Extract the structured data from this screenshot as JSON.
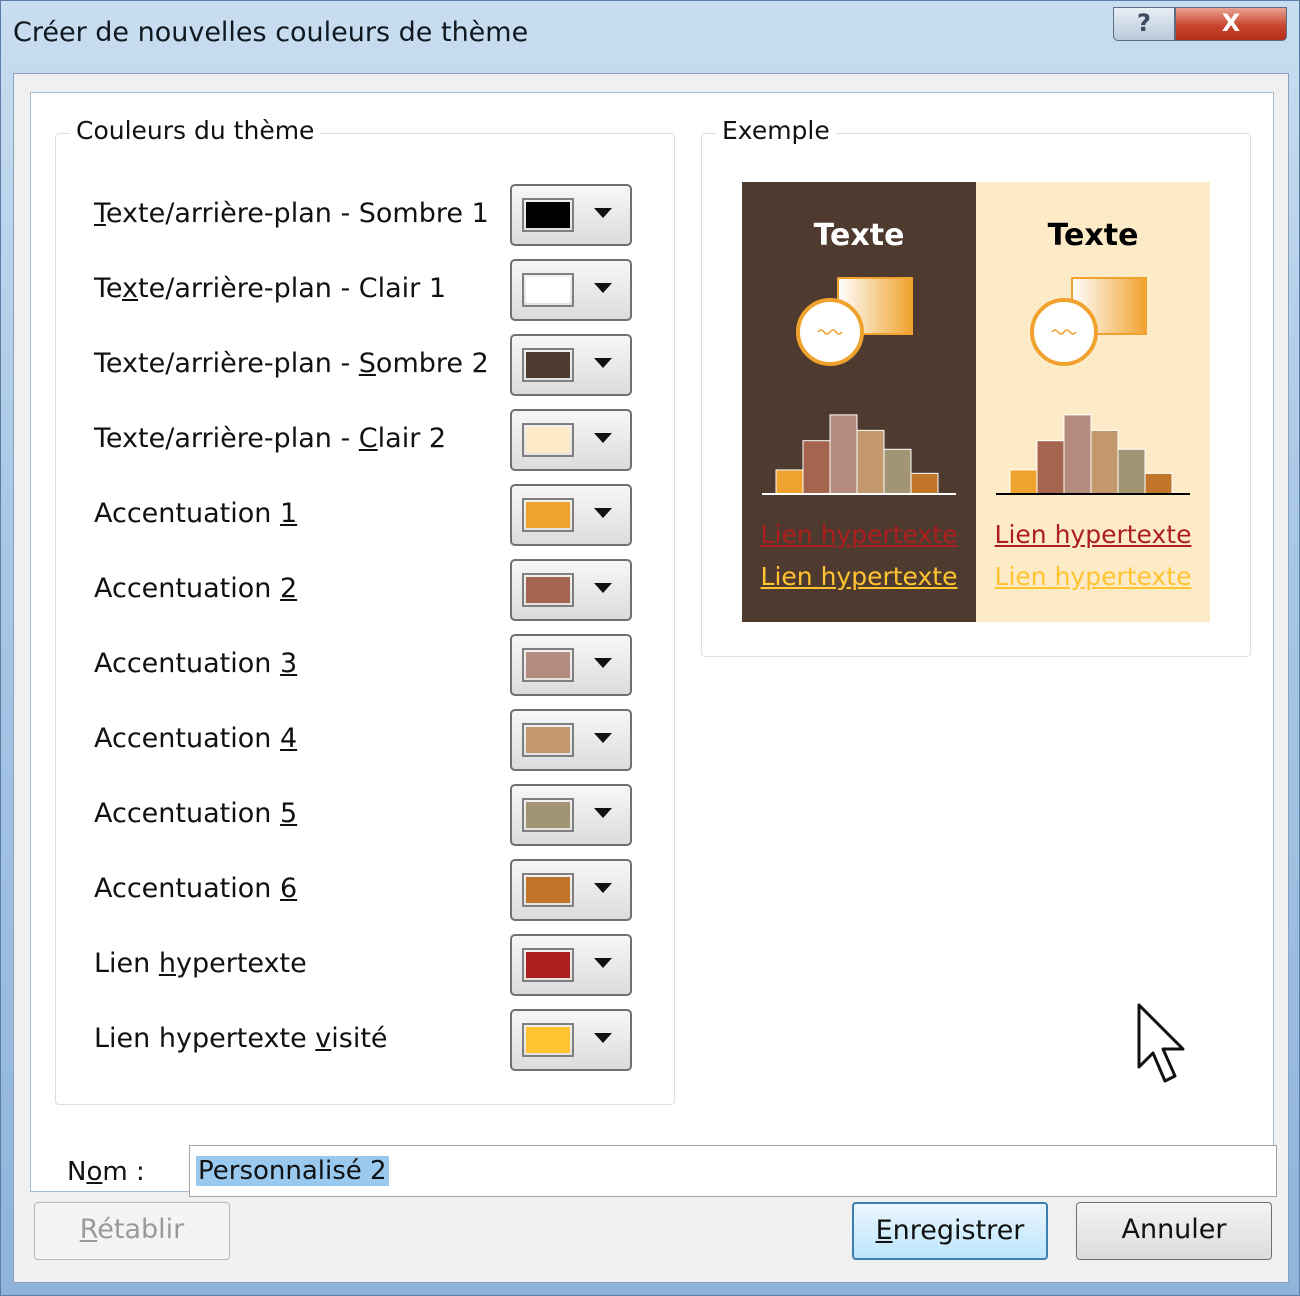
{
  "window": {
    "title": "Créer de nouvelles couleurs de thème",
    "help_glyph": "?",
    "close_glyph": "X"
  },
  "theme_colors": {
    "legend": "Couleurs du thème",
    "rows": [
      {
        "pre": "",
        "key": "T",
        "post": "exte/arrière-plan - Sombre 1",
        "color": "#000000"
      },
      {
        "pre": "Te",
        "key": "x",
        "post": "te/arrière-plan - Clair 1",
        "color": "#ffffff"
      },
      {
        "pre": "Texte/arrière-plan - ",
        "key": "S",
        "post": "ombre 2",
        "color": "#4e3a2e"
      },
      {
        "pre": "Texte/arrière-plan - ",
        "key": "C",
        "post": "lair 2",
        "color": "#fdebc8"
      },
      {
        "pre": "Accentuation ",
        "key": "1",
        "post": "",
        "color": "#f0a22e"
      },
      {
        "pre": "Accentuation ",
        "key": "2",
        "post": "",
        "color": "#a5644e"
      },
      {
        "pre": "Accentuation ",
        "key": "3",
        "post": "",
        "color": "#b58b80"
      },
      {
        "pre": "Accentuation ",
        "key": "4",
        "post": "",
        "color": "#c3986d"
      },
      {
        "pre": "Accentuation ",
        "key": "5",
        "post": "",
        "color": "#a19574"
      },
      {
        "pre": "Accentuation ",
        "key": "6",
        "post": "",
        "color": "#c17529"
      },
      {
        "pre": "Lien ",
        "key": "h",
        "post": "ypertexte",
        "color": "#ad1f1f"
      },
      {
        "pre": "Lien hypertexte ",
        "key": "v",
        "post": "isité",
        "color": "#ffc42f"
      }
    ]
  },
  "example": {
    "legend": "Exemple",
    "dark_bg": "#4e3a2e",
    "light_bg": "#fdebc8",
    "title": "Texte",
    "link": "Lien hypertexte",
    "visited_link": "Lien hypertexte",
    "link_color": "#ad1f1f",
    "visited_color": "#ffc42f",
    "bar_values": [
      0.28,
      0.62,
      0.92,
      0.74,
      0.52,
      0.24
    ]
  },
  "name_field": {
    "label_pre": "N",
    "label_key": "o",
    "label_post": "m :",
    "value": "Personnalisé 2"
  },
  "buttons": {
    "reset_key": "R",
    "reset_rest": "établir",
    "save_key": "E",
    "save_rest": "nregistrer",
    "cancel": "Annuler"
  }
}
